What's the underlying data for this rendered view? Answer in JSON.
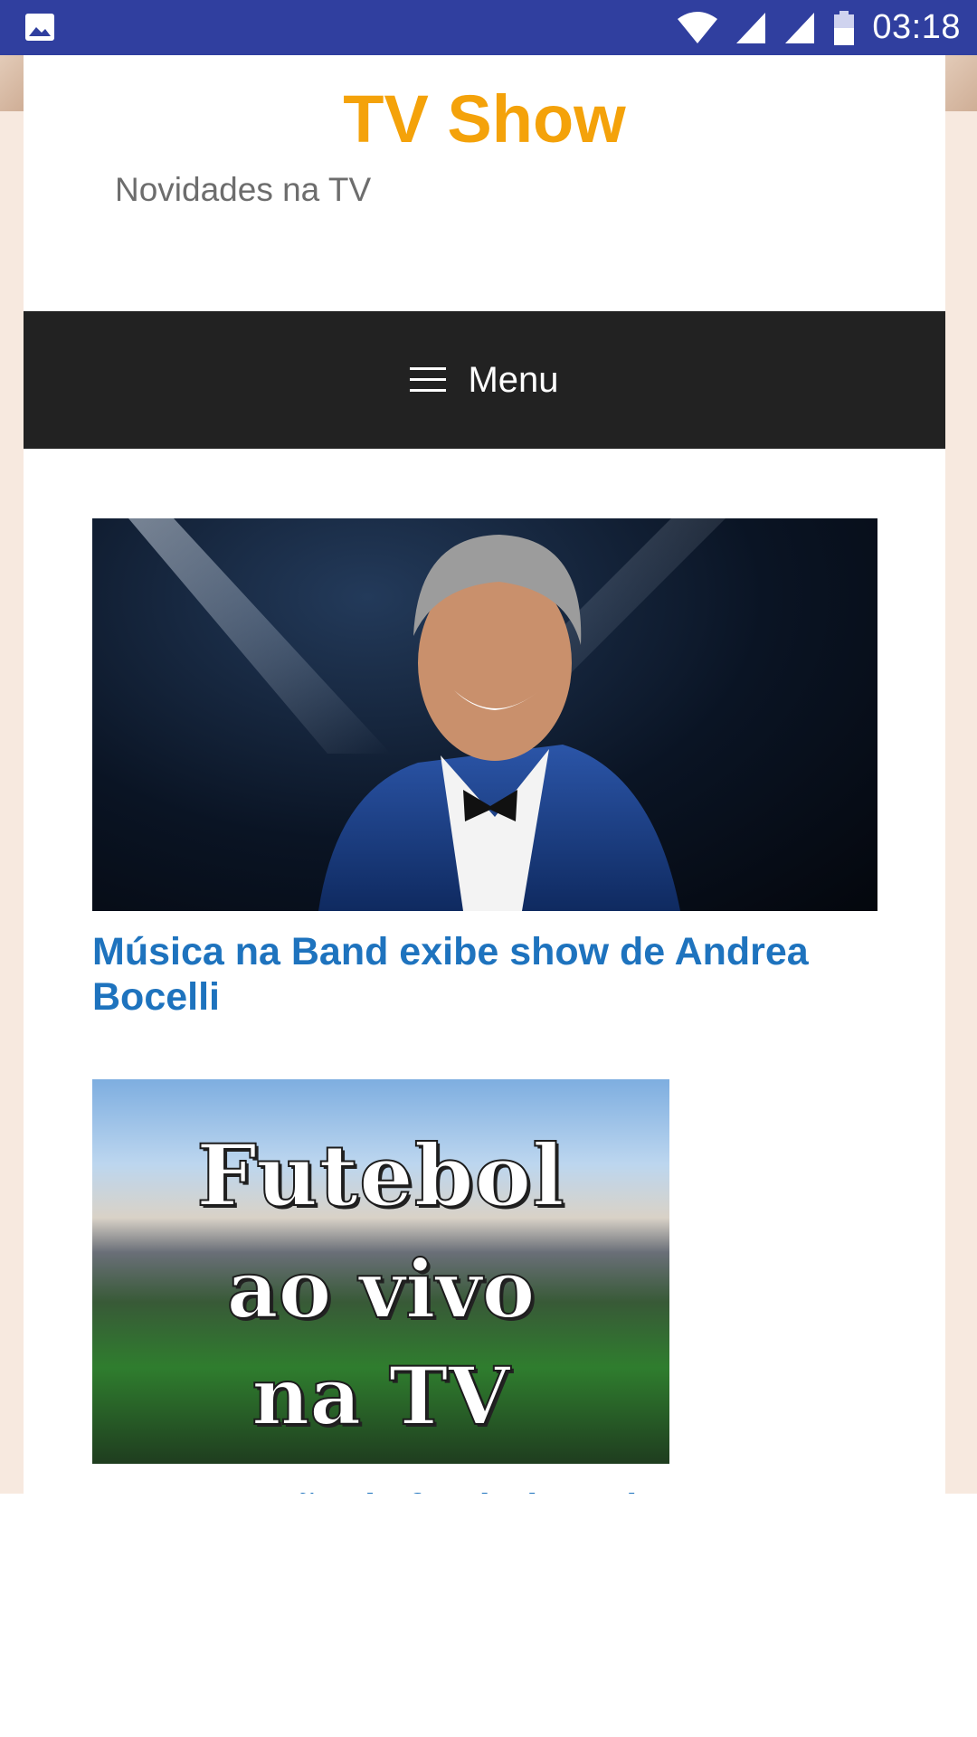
{
  "status_bar": {
    "time": "03:18",
    "background": "#303f9f",
    "icons": [
      "image-icon",
      "wifi-icon",
      "signal-icon",
      "signal-icon-2",
      "battery-icon"
    ]
  },
  "site": {
    "title": "TV Show",
    "tagline": "Novidades na TV",
    "title_color": "#f4a20a"
  },
  "menu": {
    "label": "Menu",
    "icon": "hamburger-icon",
    "background": "#222222"
  },
  "posts": [
    {
      "title": "Música na Band exibe show de Andrea Bocelli",
      "image": "singer-portrait"
    },
    {
      "title": "Programação de futebol ao vivo na TV",
      "image_text": [
        "Futebol",
        "ao vivo",
        "na TV"
      ]
    }
  ],
  "link_color": "#1e73be"
}
